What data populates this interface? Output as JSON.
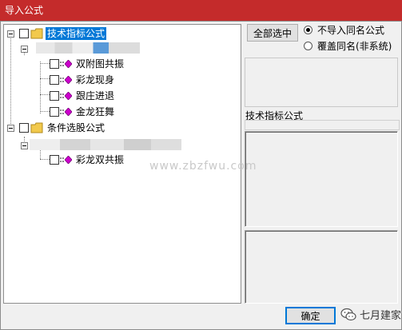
{
  "window": {
    "title": "导入公式"
  },
  "tree": {
    "groups": [
      {
        "label": "技术指标公式",
        "items": [
          "双附图共振",
          "彩龙现身",
          "跟庄进退",
          "金龙狂舞"
        ]
      },
      {
        "label": "条件选股公式",
        "items": [
          "彩龙双共振"
        ]
      }
    ]
  },
  "right_panel": {
    "select_all_label": "全部选中",
    "options": [
      {
        "label": "不导入同名公式",
        "selected": true
      },
      {
        "label": "覆盖同名(非系统)",
        "selected": false
      }
    ],
    "info_label": "技术指标公式"
  },
  "buttons": {
    "ok_label": "确定"
  },
  "watermark": {
    "text": "www.zbzfwu.com",
    "wechat_text": "七月建家"
  },
  "colors": {
    "titlebar": "#c42b2b",
    "selection": "#0078d7",
    "gem": "#cc00cc",
    "folder": "#f2c94c"
  }
}
